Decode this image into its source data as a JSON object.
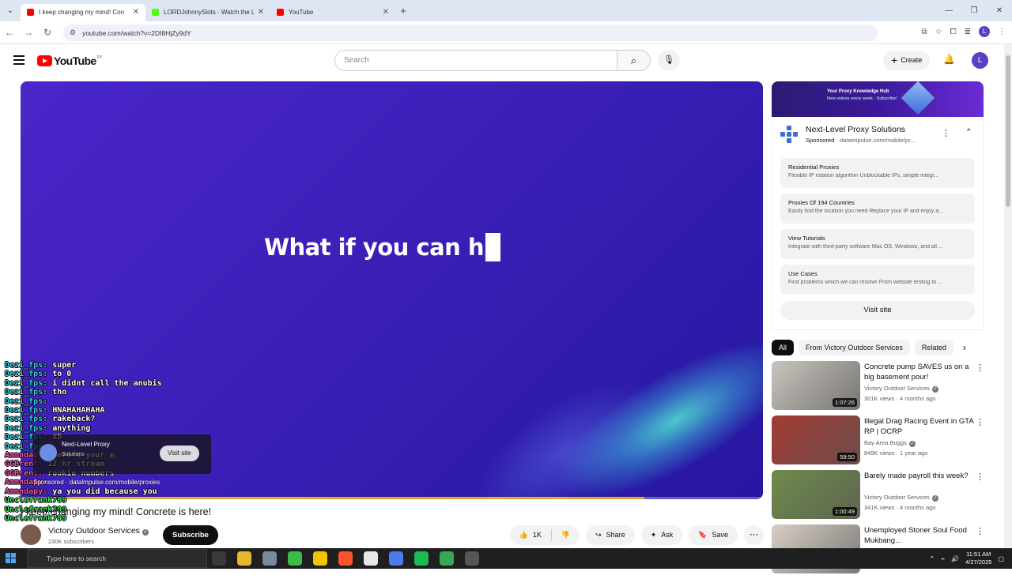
{
  "browser": {
    "tabs": [
      {
        "title": "I keep changing my mind! Con",
        "favicon_color": "#ff0000",
        "active": true
      },
      {
        "title": "LORDJohnnySlots - Watch the L",
        "favicon_color": "#53fc18",
        "active": false
      },
      {
        "title": "YouTube",
        "favicon_color": "#ff0000",
        "active": false
      }
    ],
    "url": "youtube.com/watch?v=2DI8HjZy9dY",
    "profile_initial": "L"
  },
  "youtube": {
    "logo_text": "YouTube",
    "logo_country": "PY",
    "search_placeholder": "Search",
    "create_label": "Create",
    "avatar_initial": "L"
  },
  "player": {
    "caption": "What if you can h",
    "progress_fraction": 0.84,
    "chat": [
      {
        "user": "Dezi_fps:",
        "msg": "super",
        "color": "blue"
      },
      {
        "user": "Dezi_fps:",
        "msg": "to 0",
        "color": "blue"
      },
      {
        "user": "Dezi_fps:",
        "msg": "i didnt call the anubis",
        "color": "blue"
      },
      {
        "user": "Dezi_fps:",
        "msg": "tho",
        "color": "blue"
      },
      {
        "user": "Dezi_fps:",
        "msg": "",
        "color": "blue"
      },
      {
        "user": "Dezi_fps:",
        "msg": "HNAHAHAHAHA",
        "color": "blue"
      },
      {
        "user": "Dezi_fps:",
        "msg": "rakeback?",
        "color": "blue"
      },
      {
        "user": "Dezi_fps:",
        "msg": "anything",
        "color": "blue"
      },
      {
        "user": "Dezi_fps:",
        "msg": "XD",
        "color": "blue"
      },
      {
        "user": "Dezi_fps:",
        "msg": "",
        "color": "blue"
      },
      {
        "user": "Ammndapy:",
        "msg": "here's your m",
        "color": "pink"
      },
      {
        "user": "GGBrent:",
        "msg": "12 hr stream",
        "color": "pink"
      },
      {
        "user": "GGBrent:",
        "msg": "rookie numbers",
        "color": "pink"
      },
      {
        "user": "Ammndapy:",
        "msg": "",
        "color": "pink"
      },
      {
        "user": "Ammndapy:",
        "msg": "ya you did because you",
        "color": "pink"
      },
      {
        "user": "Unclefrank709",
        "msg": "",
        "color": "green"
      },
      {
        "user": "Unclefrank709",
        "msg": "",
        "color": "green"
      },
      {
        "user": "Unclefrank709",
        "msg": "",
        "color": "green"
      }
    ],
    "ad_overlay": {
      "name": "Next-Level Proxy",
      "sub": "Solutions",
      "visit": "Visit site",
      "sponsored": "Sponsored · datalmpulse.com/mobile/proxies"
    }
  },
  "video": {
    "title": "I keep changing my mind! Concrete is here!",
    "channel": "Victory Outdoor Services",
    "subscribers": "230K subscribers",
    "subscribe_label": "Subscribe",
    "likes": "1K",
    "share_label": "Share",
    "ask_label": "Ask",
    "save_label": "Save"
  },
  "sidebar_ad": {
    "banner_title": "Your Proxy Knowledge Hub",
    "banner_sub": "New videos every week · Subscribe!",
    "title": "Next-Level Proxy Solutions",
    "sponsored": "Sponsored",
    "domain": "dataimpulse.com/mobile/pr...",
    "offers": [
      {
        "title": "Residential Proxies",
        "desc": "Flexible IP rotation algorithm Unblockable IPs, simple integr..."
      },
      {
        "title": "Proxies Of 194 Countries",
        "desc": "Easily find the location you need Replace your IP and enjoy a..."
      },
      {
        "title": "View Tutorials",
        "desc": "Integrate with third-party software Mac OS, Windows, and all ..."
      },
      {
        "title": "Use Cases",
        "desc": "Find problems which we can resolve From website testing to ..."
      }
    ],
    "visit_label": "Visit site"
  },
  "chips": [
    "All",
    "From Victory Outdoor Services",
    "Related"
  ],
  "recommendations": [
    {
      "title": "Concrete pump SAVES us on a big basement pour!",
      "channel": "Victory Outdoor Services",
      "verified": true,
      "meta": "301K views · 4 months ago",
      "duration": "1:07:26",
      "thumb_color": "#c9c4bd"
    },
    {
      "title": "Illegal Drag Racing Event in GTA RP | OCRP",
      "channel": "Bay Area Buggs",
      "verified": true,
      "meta": "849K views · 1 year ago",
      "duration": "59:50",
      "thumb_color": "#a43a33"
    },
    {
      "title": "Barely made payroll this week?",
      "channel": "Victory Outdoor Services",
      "verified": true,
      "meta": "341K views · 4 months ago",
      "duration": "1:00:49",
      "thumb_color": "#6f8b4a"
    },
    {
      "title": "Unemployed Stoner Soul Food Mukbang...",
      "channel": "",
      "verified": false,
      "meta": "",
      "duration": "",
      "thumb_color": "#d8cfc6"
    }
  ],
  "taskbar": {
    "search_placeholder": "Type here to search",
    "time": "11:51 AM",
    "date": "4/27/2025"
  }
}
